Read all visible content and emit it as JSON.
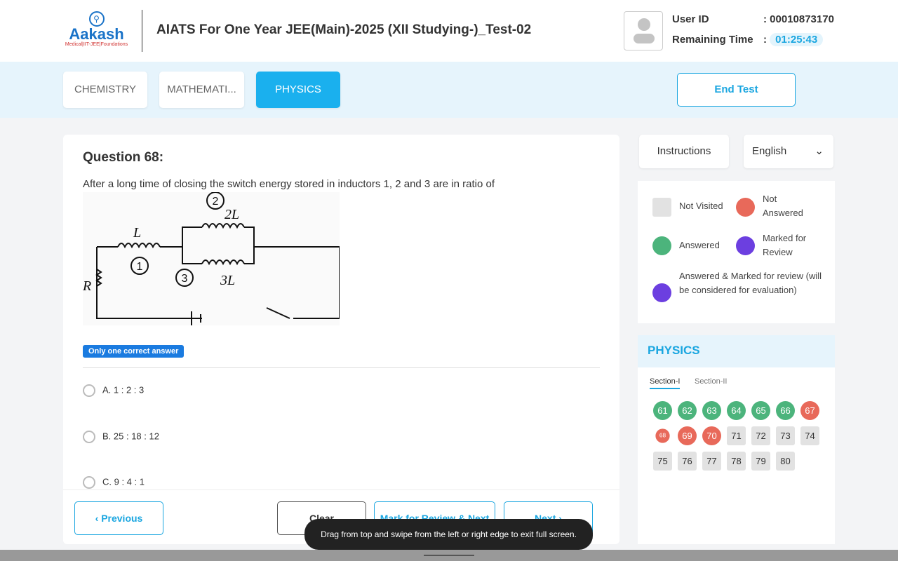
{
  "header": {
    "logo_text": "Aakash",
    "logo_tagline": "Medical|IIT-JEE|Foundations",
    "title": "AIATS For One Year JEE(Main)-2025 (XII Studying-)_Test-02",
    "user_id_label": "User ID",
    "user_id": ": 00010873170",
    "time_label": "Remaining Time",
    "time_colon": ":",
    "time": "01:25:43"
  },
  "tabs": [
    {
      "label": "CHEMISTRY"
    },
    {
      "label": "MATHEMATI..."
    },
    {
      "label": "PHYSICS",
      "active": true
    }
  ],
  "end_test": "End Test",
  "question": {
    "number": "Question 68:",
    "text": "After a long time of closing the switch energy stored in inductors 1, 2 and 3 are in ratio of",
    "figure_labels": {
      "l1": "L",
      "l2": "2L",
      "l3": "3L",
      "n1": "1",
      "n2": "2",
      "n3": "3",
      "r": "R"
    },
    "badge": "Only one correct answer",
    "options": [
      "A. 1 : 2 : 3",
      "B. 25 : 18 : 12",
      "C. 9 : 4 : 1"
    ]
  },
  "footer": {
    "previous": "Previous",
    "clear": "Clear",
    "mark": "Mark for Review & Next",
    "next": "Next"
  },
  "side": {
    "instructions": "Instructions",
    "language": "English"
  },
  "legend": {
    "not_visited": "Not Visited",
    "not_answered": "Not Answered",
    "answered": "Answered",
    "marked": "Marked for Review",
    "answered_marked": "Answered & Marked for review (will be considered for evaluation)"
  },
  "colors": {
    "answered": "#4cb47c",
    "not_answered": "#e8695a",
    "marked": "#6c3fe0",
    "not_visited": "#e2e2e2",
    "accent": "#1ab0ee"
  },
  "palette": {
    "title": "PHYSICS",
    "sections": [
      "Section-I",
      "Section-II"
    ],
    "questions": [
      {
        "n": "61",
        "s": "g"
      },
      {
        "n": "62",
        "s": "g"
      },
      {
        "n": "63",
        "s": "g"
      },
      {
        "n": "64",
        "s": "g"
      },
      {
        "n": "65",
        "s": "g"
      },
      {
        "n": "66",
        "s": "g"
      },
      {
        "n": "67",
        "s": "r"
      },
      {
        "n": "68",
        "s": "r",
        "current": true
      },
      {
        "n": "69",
        "s": "r"
      },
      {
        "n": "70",
        "s": "r"
      },
      {
        "n": "71",
        "s": "n"
      },
      {
        "n": "72",
        "s": "n"
      },
      {
        "n": "73",
        "s": "n"
      },
      {
        "n": "74",
        "s": "n"
      },
      {
        "n": "75",
        "s": "n"
      },
      {
        "n": "76",
        "s": "n"
      },
      {
        "n": "77",
        "s": "n"
      },
      {
        "n": "78",
        "s": "n"
      },
      {
        "n": "79",
        "s": "n"
      },
      {
        "n": "80",
        "s": "n"
      }
    ]
  },
  "toast": "Drag from top and swipe from the left or right edge to exit full screen."
}
